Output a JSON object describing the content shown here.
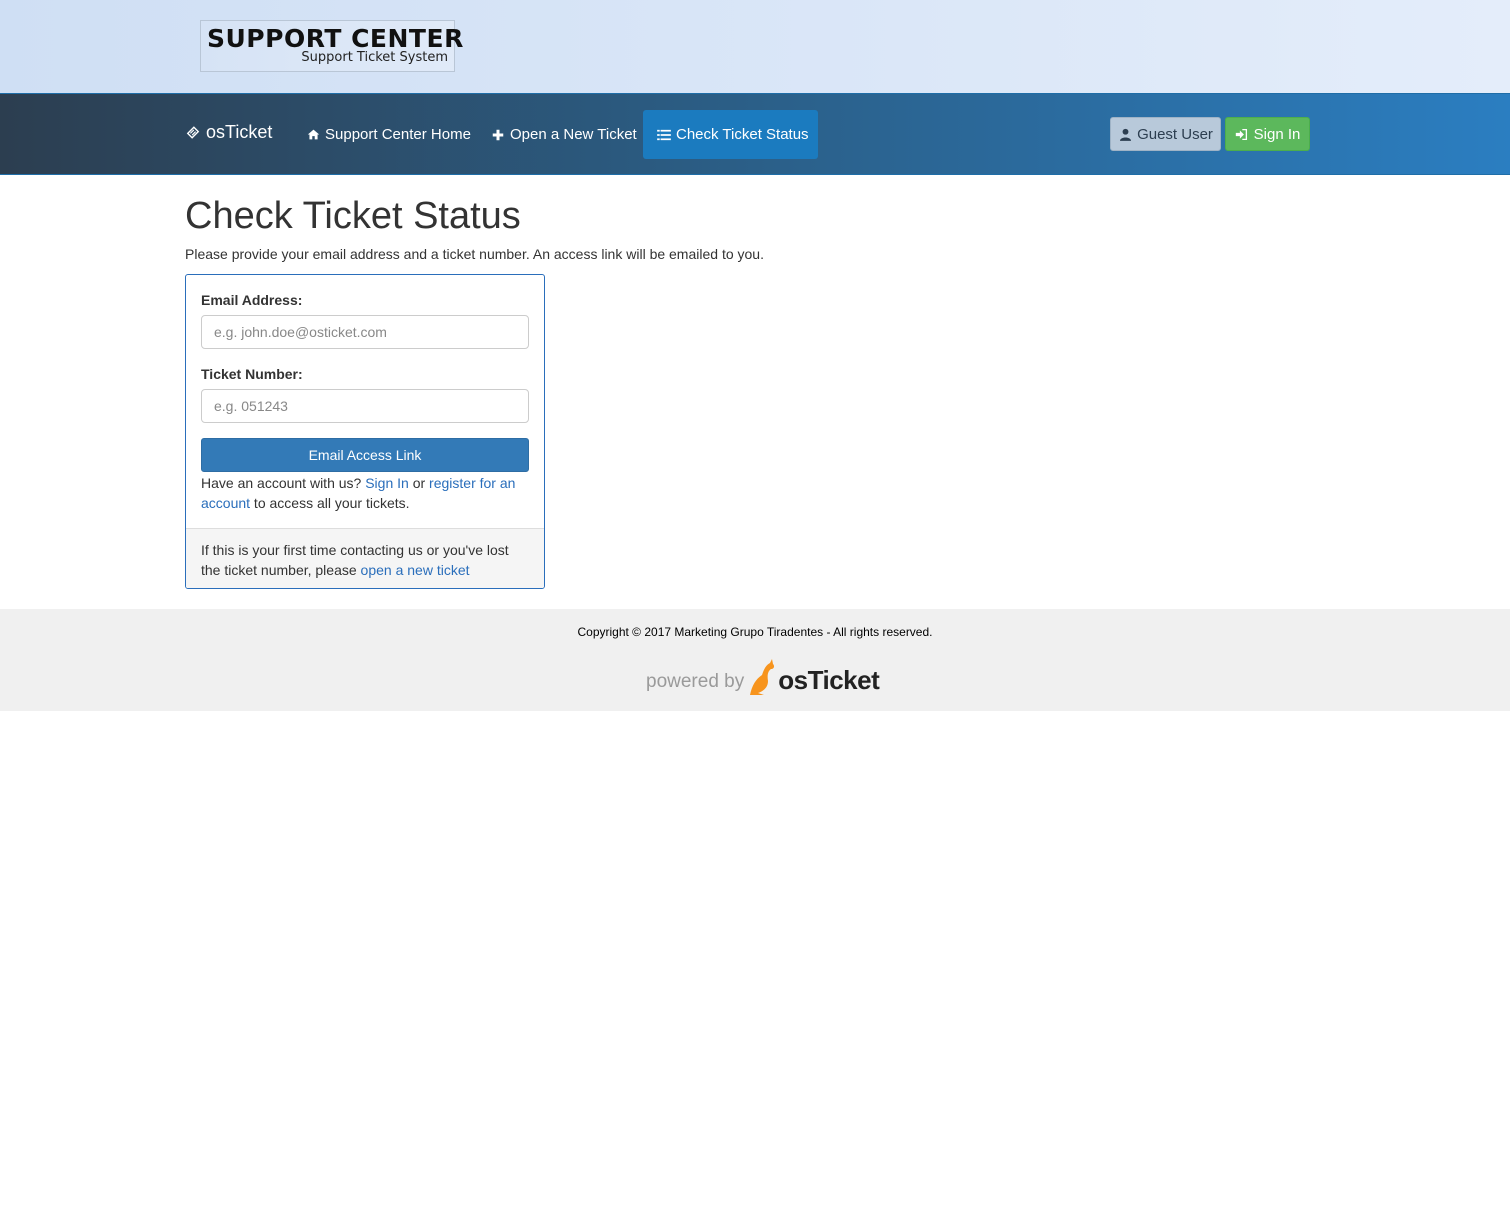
{
  "header": {
    "logo_title": "SUPPORT CENTER",
    "logo_subtitle": "Support Ticket System"
  },
  "navbar": {
    "brand": "osTicket",
    "items": [
      {
        "label": "Support Center Home",
        "icon": "home-icon"
      },
      {
        "label": "Open a New Ticket",
        "icon": "plus-icon"
      },
      {
        "label": "Check Ticket Status",
        "icon": "list-icon",
        "active": true
      }
    ],
    "guest_label": "Guest User",
    "signin_label": "Sign In"
  },
  "main": {
    "title": "Check Ticket Status",
    "intro": "Please provide your email address and a ticket number. An access link will be emailed to you.",
    "email": {
      "label": "Email Address:",
      "placeholder": "e.g. john.doe@osticket.com",
      "value": ""
    },
    "ticket": {
      "label": "Ticket Number:",
      "placeholder": "e.g. 051243",
      "value": ""
    },
    "submit_label": "Email Access Link",
    "account": {
      "prefix": "Have an account with us? ",
      "signin_link": "Sign In",
      "middle": " or ",
      "register_link": "register for an account",
      "suffix": " to access all your tickets."
    },
    "first_time": {
      "prefix": "If this is your first time contacting us or you've lost the ticket number, please ",
      "link": "open a new ticket"
    }
  },
  "footer": {
    "copyright": "Copyright © 2017 Marketing Grupo Tiradentes - All rights reserved.",
    "powered_by": "powered by",
    "brand": "osTicket"
  },
  "colors": {
    "accent": "#337ab7",
    "link": "#2a6ebb",
    "success": "#5cb85c",
    "nav_active": "#1b7bbf"
  }
}
